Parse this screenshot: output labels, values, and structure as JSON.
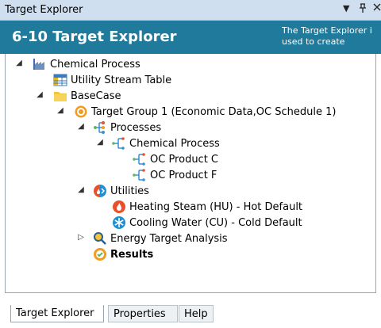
{
  "window": {
    "title": "Target Explorer",
    "dropdown_icon": "dropdown-arrow-icon",
    "pin_icon": "pin-icon",
    "close_icon": "close-icon"
  },
  "header": {
    "title": "6-10 Target Explorer",
    "desc_line1": "The Target Explorer i",
    "desc_line2": "used to create"
  },
  "tree": {
    "root": "Chemical Process",
    "utility_stream_table": "Utility Stream Table",
    "basecase": "BaseCase",
    "target_group": "Target Group 1 (Economic Data,OC Schedule 1)",
    "processes": "Processes",
    "chemical_process": "Chemical Process",
    "product_c": "OC Product C",
    "product_f": "OC Product F",
    "utilities": "Utilities",
    "heating_steam": "Heating Steam (HU) - Hot Default",
    "cooling_water": "Cooling Water (CU) - Cold Default",
    "energy_target": "Energy Target Analysis",
    "results": "Results"
  },
  "tabs": [
    "Target Explorer",
    "Properties",
    "Help"
  ],
  "colors": {
    "header_bg": "#1f7a9c",
    "titlebar_bg": "#cfdff0",
    "heating_icon": "#e8502a",
    "cooling_icon": "#1c8fd6"
  }
}
